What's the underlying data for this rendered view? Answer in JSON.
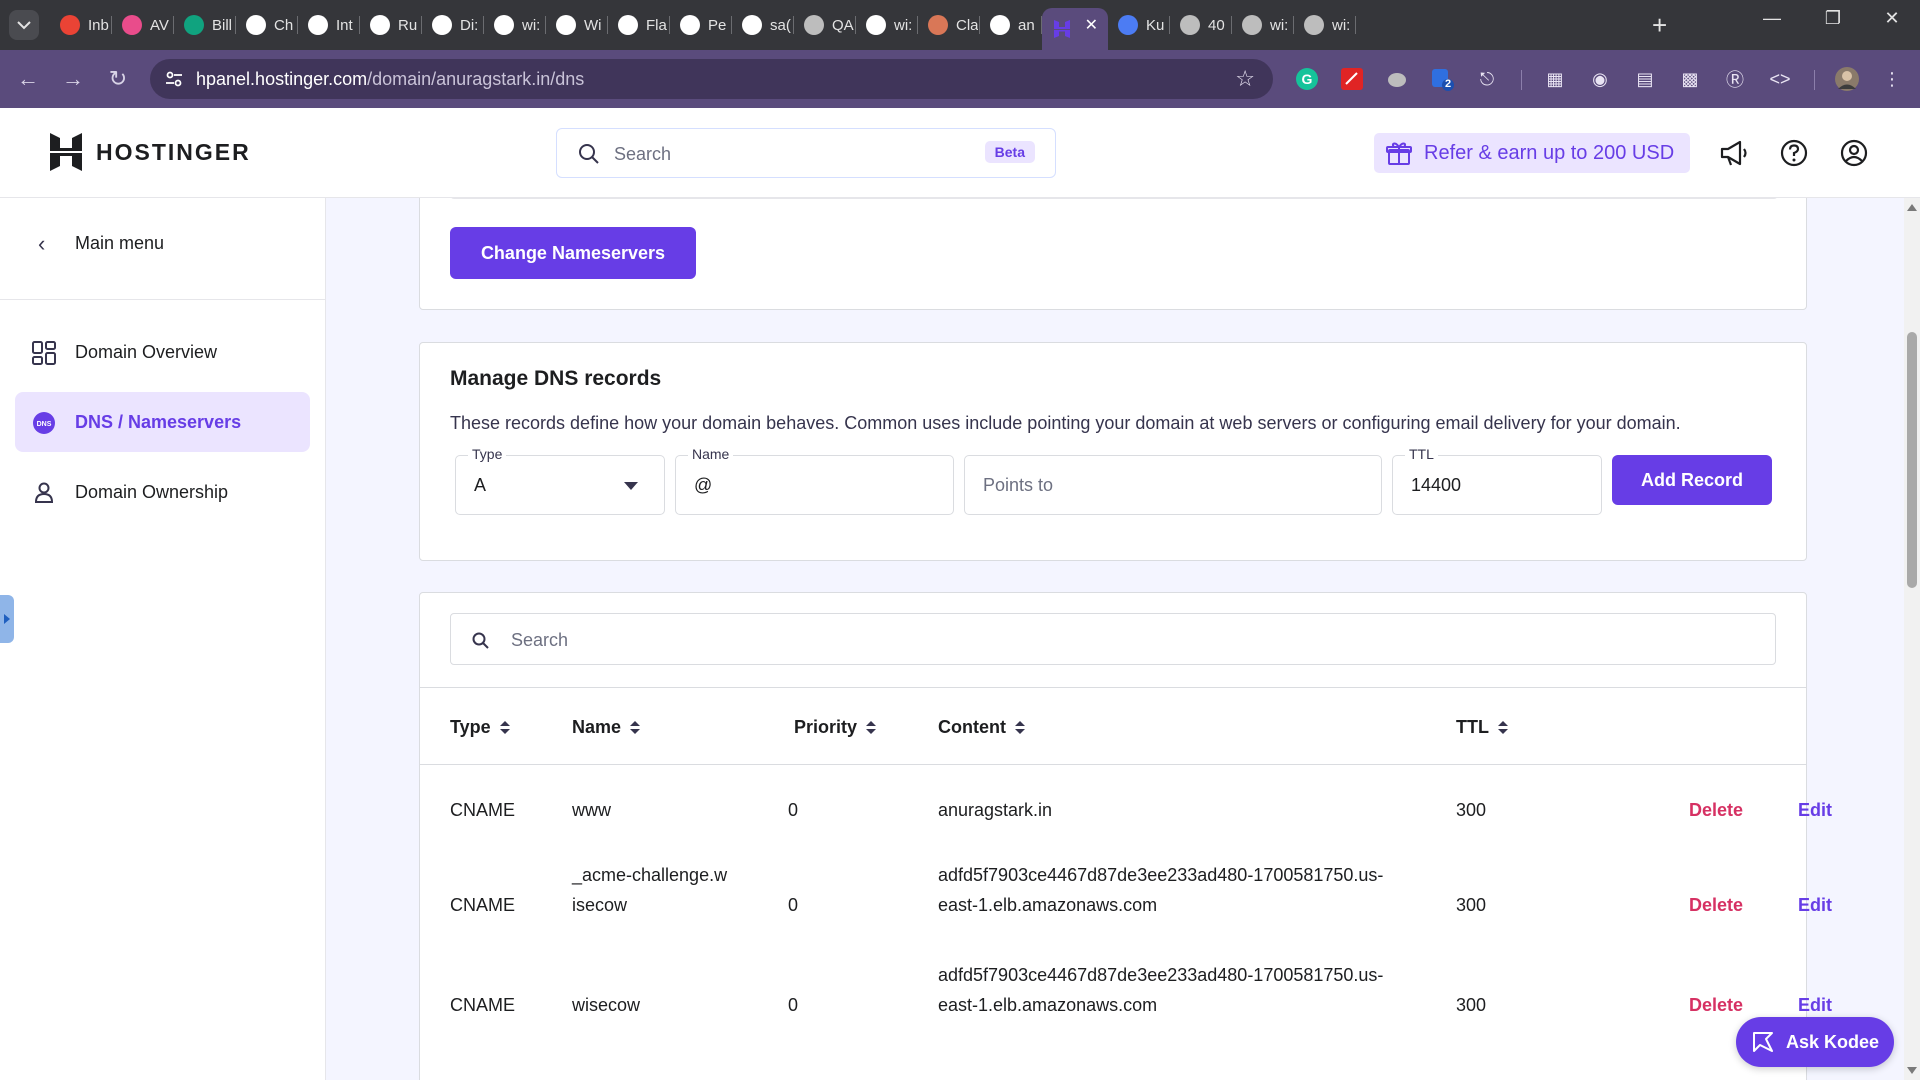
{
  "browser": {
    "tabs": [
      {
        "label": "Inb",
        "icon": "gmail-icon",
        "color": "#ea4335"
      },
      {
        "label": "AV",
        "icon": "cube-icon",
        "color": "#e94c8b"
      },
      {
        "label": "Bill",
        "icon": "openai-icon",
        "color": "#10a37f"
      },
      {
        "label": "Ch",
        "icon": "openai-icon",
        "color": "#ffffff"
      },
      {
        "label": "Int",
        "icon": "openai-icon",
        "color": "#ffffff"
      },
      {
        "label": "Ru",
        "icon": "openai-icon",
        "color": "#ffffff"
      },
      {
        "label": "Di:",
        "icon": "openai-icon",
        "color": "#ffffff"
      },
      {
        "label": "wi:",
        "icon": "github-icon",
        "color": "#ffffff"
      },
      {
        "label": "Wi",
        "icon": "openai-icon",
        "color": "#ffffff"
      },
      {
        "label": "Fla",
        "icon": "openai-icon",
        "color": "#ffffff"
      },
      {
        "label": "Pe",
        "icon": "github-icon",
        "color": "#ffffff"
      },
      {
        "label": "sa(",
        "icon": "github-icon",
        "color": "#ffffff"
      },
      {
        "label": "QA",
        "icon": "globe-icon",
        "color": "#bdbdbd"
      },
      {
        "label": "wi:",
        "icon": "github-icon",
        "color": "#ffffff"
      },
      {
        "label": "Cla",
        "icon": "claude-icon",
        "color": "#d97757"
      },
      {
        "label": "an",
        "icon": "github-icon",
        "color": "#ffffff"
      }
    ],
    "active_tab": {
      "label": "",
      "icon": "hostinger-icon",
      "color": "#673de6"
    },
    "tabs_after": [
      {
        "label": "Ku",
        "icon": "kubernetes-icon",
        "color": "#4c7cf3"
      },
      {
        "label": "40",
        "icon": "globe-icon",
        "color": "#bdbdbd"
      },
      {
        "label": "wi:",
        "icon": "globe-icon",
        "color": "#bdbdbd"
      },
      {
        "label": "wi:",
        "icon": "globe-icon",
        "color": "#bdbdbd"
      }
    ],
    "url_host": "hpanel.hostinger.com",
    "url_path": "/domain/anuragstark.in/dns",
    "extension_badge": "2"
  },
  "header": {
    "logo_text": "HOSTINGER",
    "search_placeholder": "Search",
    "beta_label": "Beta",
    "refer_label": "Refer & earn up to 200 USD"
  },
  "sidebar": {
    "main_menu_label": "Main menu",
    "items": [
      {
        "label": "Domain Overview",
        "icon": "grid-icon",
        "active": false
      },
      {
        "label": "DNS / Nameservers",
        "icon": "dns-icon",
        "active": true
      },
      {
        "label": "Domain Ownership",
        "icon": "person-icon",
        "active": false
      }
    ],
    "dns_icon_text": "DNS"
  },
  "nameservers": {
    "change_button": "Change Nameservers"
  },
  "dns_form": {
    "title": "Manage DNS records",
    "description": "These records define how your domain behaves. Common uses include pointing your domain at web servers or configuring email delivery for your domain.",
    "type_label": "Type",
    "type_value": "A",
    "name_label": "Name",
    "name_value": "@",
    "points_to_placeholder": "Points to",
    "ttl_label": "TTL",
    "ttl_value": "14400",
    "add_button": "Add Record"
  },
  "records_table": {
    "search_placeholder": "Search",
    "columns": [
      "Type",
      "Name",
      "Priority",
      "Content",
      "TTL"
    ],
    "delete_label": "Delete",
    "edit_label": "Edit",
    "rows": [
      {
        "type": "CNAME",
        "name": [
          "www"
        ],
        "priority": "0",
        "content": [
          "anuragstark.in"
        ],
        "ttl": "300"
      },
      {
        "type": "CNAME",
        "name": [
          "_acme-challenge.w",
          "isecow"
        ],
        "priority": "0",
        "content": [
          "adfd5f7903ce4467d87de3ee233ad480-1700581750.us-",
          "east-1.elb.amazonaws.com"
        ],
        "ttl": "300"
      },
      {
        "type": "CNAME",
        "name": [
          "wisecow"
        ],
        "priority": "0",
        "content": [
          "adfd5f7903ce4467d87de3ee233ad480-1700581750.us-",
          "east-1.elb.amazonaws.com"
        ],
        "ttl": "300"
      }
    ]
  },
  "assistant": {
    "label": "Ask Kodee"
  },
  "colors": {
    "accent": "#673de6",
    "accent_light": "#ebe4ff",
    "danger": "#d63163",
    "browser_toolbar": "#5a4b7c"
  }
}
